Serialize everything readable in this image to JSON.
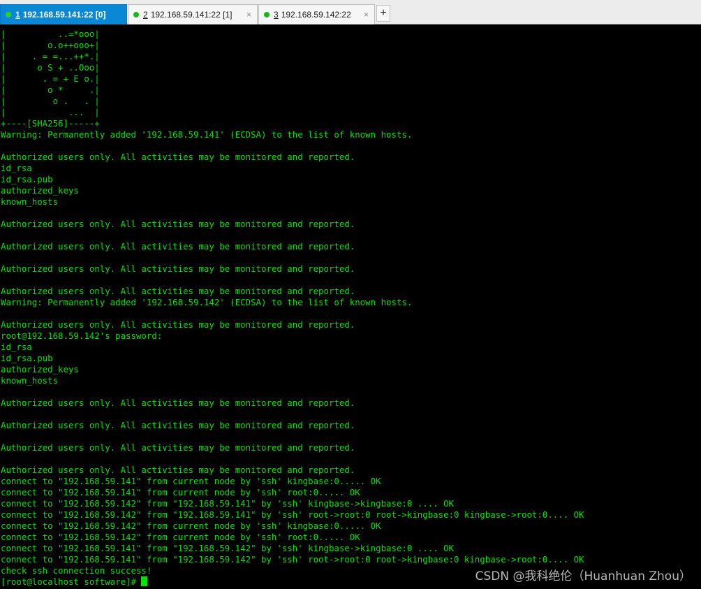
{
  "tabs": [
    {
      "number": "1",
      "label": "192.168.59.141:22 [0]",
      "active": true,
      "close": "×"
    },
    {
      "number": "2",
      "label": "192.168.59.141:22 [1]",
      "active": false,
      "close": "×"
    },
    {
      "number": "3",
      "label": "192.168.59.142:22",
      "active": false,
      "close": "×"
    }
  ],
  "new_tab_label": "+",
  "colors": {
    "terminal_bg": "#000000",
    "terminal_fg": "#00e400",
    "active_tab": "#0a88d6",
    "status_dot": "#17b817"
  },
  "terminal": {
    "lines": [
      "|          ..=*ooo|",
      "|        o.o++ooo+|",
      "|     . = =...++*.|",
      "|      o S + ..Ooo|",
      "|       . = + E o.|",
      "|        o *     .|",
      "|         o .   . |",
      "|            ...  |",
      "+----[SHA256]-----+",
      "Warning: Permanently added '192.168.59.141' (ECDSA) to the list of known hosts.",
      "",
      "Authorized users only. All activities may be monitored and reported.",
      "id_rsa",
      "id_rsa.pub",
      "authorized_keys",
      "known_hosts",
      "",
      "Authorized users only. All activities may be monitored and reported.",
      "",
      "Authorized users only. All activities may be monitored and reported.",
      "",
      "Authorized users only. All activities may be monitored and reported.",
      "",
      "Authorized users only. All activities may be monitored and reported.",
      "Warning: Permanently added '192.168.59.142' (ECDSA) to the list of known hosts.",
      "",
      "Authorized users only. All activities may be monitored and reported.",
      "root@192.168.59.142's password:",
      "id_rsa",
      "id_rsa.pub",
      "authorized_keys",
      "known_hosts",
      "",
      "Authorized users only. All activities may be monitored and reported.",
      "",
      "Authorized users only. All activities may be monitored and reported.",
      "",
      "Authorized users only. All activities may be monitored and reported.",
      "",
      "Authorized users only. All activities may be monitored and reported.",
      "connect to \"192.168.59.141\" from current node by 'ssh' kingbase:0..... OK",
      "connect to \"192.168.59.141\" from current node by 'ssh' root:0..... OK",
      "connect to \"192.168.59.142\" from \"192.168.59.141\" by 'ssh' kingbase->kingbase:0 .... OK",
      "connect to \"192.168.59.142\" from \"192.168.59.141\" by 'ssh' root->root:0 root->kingbase:0 kingbase->root:0.... OK",
      "connect to \"192.168.59.142\" from current node by 'ssh' kingbase:0..... OK",
      "connect to \"192.168.59.142\" from current node by 'ssh' root:0..... OK",
      "connect to \"192.168.59.141\" from \"192.168.59.142\" by 'ssh' kingbase->kingbase:0 .... OK",
      "connect to \"192.168.59.141\" from \"192.168.59.142\" by 'ssh' root->root:0 root->kingbase:0 kingbase->root:0.... OK",
      "check ssh connection success!"
    ],
    "prompt": "[root@localhost software]# "
  },
  "watermark": "CSDN @我科绝伦（Huanhuan Zhou）"
}
